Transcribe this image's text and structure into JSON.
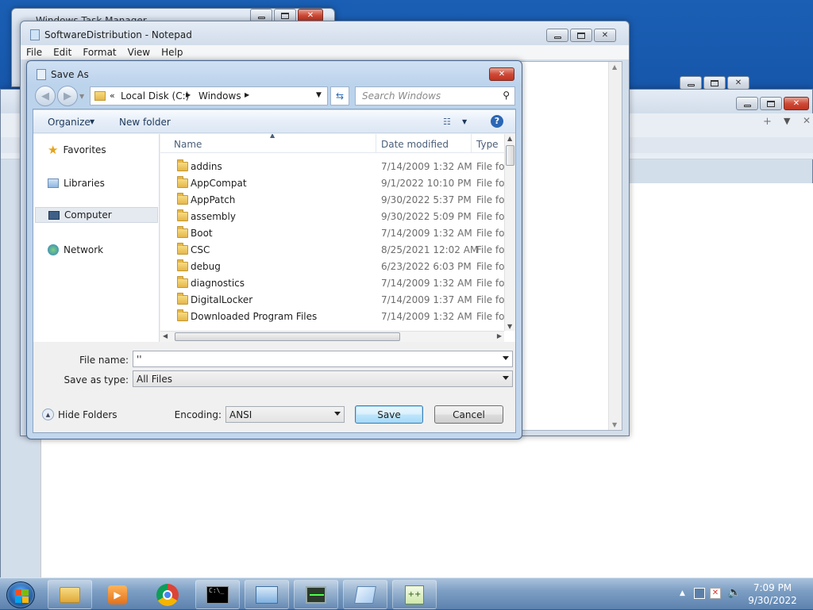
{
  "background_windows": {
    "back1_title": "Windows Task Manager",
    "notepad_title": "SoftwareDistribution - Notepad",
    "notepad_menu": [
      "File",
      "Edit",
      "Format",
      "View",
      "Help"
    ]
  },
  "dialog": {
    "title": "Save As",
    "breadcrumb": [
      "Local Disk (C:)",
      "Windows"
    ],
    "search_placeholder": "Search Windows",
    "toolbar": {
      "organize": "Organize",
      "new_folder": "New folder"
    },
    "nav": [
      "Favorites",
      "Libraries",
      "Computer",
      "Network"
    ],
    "columns": {
      "name": "Name",
      "date": "Date modified",
      "type": "Type"
    },
    "files": [
      {
        "name": "addins",
        "date": "7/14/2009 1:32 AM",
        "type": "File folder"
      },
      {
        "name": "AppCompat",
        "date": "9/1/2022 10:10 PM",
        "type": "File folder"
      },
      {
        "name": "AppPatch",
        "date": "9/30/2022 5:37 PM",
        "type": "File folder"
      },
      {
        "name": "assembly",
        "date": "9/30/2022 5:09 PM",
        "type": "File folder"
      },
      {
        "name": "Boot",
        "date": "7/14/2009 1:32 AM",
        "type": "File folder"
      },
      {
        "name": "CSC",
        "date": "8/25/2021 12:02 AM",
        "type": "File folder"
      },
      {
        "name": "debug",
        "date": "6/23/2022 6:03 PM",
        "type": "File folder"
      },
      {
        "name": "diagnostics",
        "date": "7/14/2009 1:32 AM",
        "type": "File folder"
      },
      {
        "name": "DigitalLocker",
        "date": "7/14/2009 1:37 AM",
        "type": "File folder"
      },
      {
        "name": "Downloaded Program Files",
        "date": "7/14/2009 1:32 AM",
        "type": "File folder"
      }
    ],
    "filename_label": "File name:",
    "filename_value": "''",
    "savetype_label": "Save as type:",
    "savetype_value": "All Files",
    "hide_folders": "Hide Folders",
    "encoding_label": "Encoding:",
    "encoding_value": "ANSI",
    "save": "Save",
    "cancel": "Cancel"
  },
  "taskbar": {
    "time": "7:09 PM",
    "date": "9/30/2022"
  }
}
